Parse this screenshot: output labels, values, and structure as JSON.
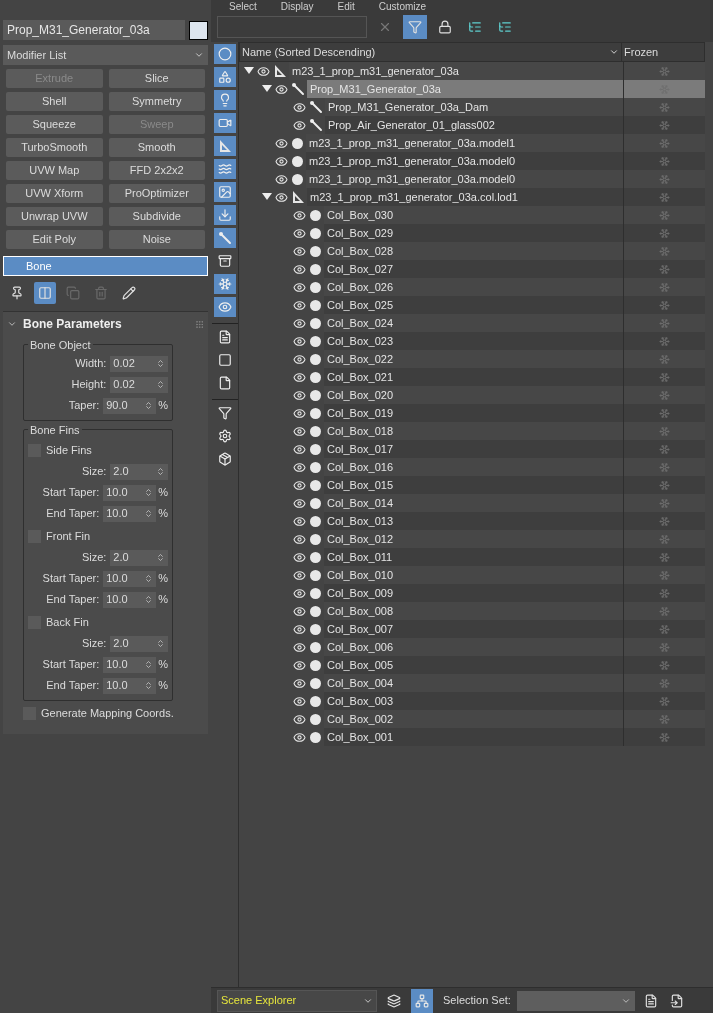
{
  "menu": [
    {
      "label": "Select"
    },
    {
      "label": "Display"
    },
    {
      "label": "Edit"
    },
    {
      "label": "Customize"
    }
  ],
  "object_name": "Prop_M31_Generator_03a",
  "modifier_list": "Modifier List",
  "modifier_buttons": [
    {
      "label": "Extrude",
      "disabled": true
    },
    {
      "label": "Slice",
      "disabled": false
    },
    {
      "label": "Shell",
      "disabled": false
    },
    {
      "label": "Symmetry",
      "disabled": false
    },
    {
      "label": "Squeeze",
      "disabled": false
    },
    {
      "label": "Sweep",
      "disabled": true
    },
    {
      "label": "TurboSmooth",
      "disabled": false
    },
    {
      "label": "Smooth",
      "disabled": false
    },
    {
      "label": "UVW Map",
      "disabled": false
    },
    {
      "label": "FFD 2x2x2",
      "disabled": false
    },
    {
      "label": "UVW Xform",
      "disabled": false
    },
    {
      "label": "ProOptimizer",
      "disabled": false
    },
    {
      "label": "Unwrap UVW",
      "disabled": false
    },
    {
      "label": "Subdivide",
      "disabled": false
    },
    {
      "label": "Edit Poly",
      "disabled": false
    },
    {
      "label": "Noise",
      "disabled": false
    }
  ],
  "stack": [
    {
      "label": "Bone",
      "selected": true
    }
  ],
  "stack_tools": [
    {
      "kind": "pin",
      "on": false,
      "disabled": false
    },
    {
      "kind": "show-end",
      "on": true,
      "disabled": false
    },
    {
      "kind": "make-unique",
      "on": false,
      "disabled": true
    },
    {
      "kind": "remove",
      "on": false,
      "disabled": true
    },
    {
      "kind": "configure",
      "on": false,
      "disabled": false
    }
  ],
  "rollout": {
    "title": "Bone Parameters",
    "expanded": true,
    "groups": [
      {
        "title": "Bone Object",
        "items": [
          {
            "kind": "spinner",
            "label": "Width:",
            "value": "0.02"
          },
          {
            "kind": "spinner",
            "label": "Height:",
            "value": "0.02"
          },
          {
            "kind": "spinner",
            "label": "Taper:",
            "value": "90.0",
            "unit": "%"
          }
        ]
      },
      {
        "title": "Bone Fins",
        "items": [
          {
            "kind": "checkbox",
            "label": "Side Fins",
            "checked": false
          },
          {
            "kind": "spinner",
            "label": "Size:",
            "value": "2.0"
          },
          {
            "kind": "spinner",
            "label": "Start Taper:",
            "value": "10.0",
            "unit": "%"
          },
          {
            "kind": "spinner",
            "label": "End Taper:",
            "value": "10.0",
            "unit": "%"
          },
          {
            "kind": "checkbox",
            "label": "Front Fin",
            "checked": false
          },
          {
            "kind": "spinner",
            "label": "Size:",
            "value": "2.0"
          },
          {
            "kind": "spinner",
            "label": "Start Taper:",
            "value": "10.0",
            "unit": "%"
          },
          {
            "kind": "spinner",
            "label": "End Taper:",
            "value": "10.0",
            "unit": "%"
          },
          {
            "kind": "checkbox",
            "label": "Back Fin",
            "checked": false
          },
          {
            "kind": "spinner",
            "label": "Size:",
            "value": "2.0"
          },
          {
            "kind": "spinner",
            "label": "Start Taper:",
            "value": "10.0",
            "unit": "%"
          },
          {
            "kind": "spinner",
            "label": "End Taper:",
            "value": "10.0",
            "unit": "%"
          }
        ]
      }
    ],
    "options": [
      {
        "kind": "checkbox",
        "label": "Generate Mapping Coords.",
        "checked": false
      }
    ]
  },
  "explorer_tools": [
    {
      "kind": "clear",
      "on": false
    },
    {
      "kind": "filter",
      "on": true
    },
    {
      "kind": "lock",
      "on": false
    },
    {
      "kind": "expand",
      "on": false
    },
    {
      "kind": "collapse",
      "on": false
    }
  ],
  "side_toolbar": [
    {
      "kind": "geometry",
      "on": true
    },
    {
      "kind": "shapes",
      "on": true
    },
    {
      "kind": "lights",
      "on": true
    },
    {
      "kind": "cameras",
      "on": true
    },
    {
      "kind": "helpers",
      "on": true
    },
    {
      "kind": "spacewarps",
      "on": true
    },
    {
      "kind": "groups",
      "on": true
    },
    {
      "kind": "xrefs",
      "on": true
    },
    {
      "kind": "bones",
      "on": true
    },
    {
      "kind": "containers",
      "on": false
    },
    {
      "kind": "frozen",
      "on": true
    },
    {
      "kind": "hidden",
      "on": true
    },
    {
      "kind": "separator"
    },
    {
      "kind": "display-all",
      "on": false
    },
    {
      "kind": "display-none",
      "on": false
    },
    {
      "kind": "invert",
      "on": false
    },
    {
      "kind": "separator"
    },
    {
      "kind": "filter",
      "on": false
    },
    {
      "kind": "filter-settings",
      "on": false
    },
    {
      "kind": "container-open",
      "on": false
    }
  ],
  "columns": [
    "Name (Sorted Descending)",
    "Frozen"
  ],
  "tree": [
    {
      "name": "m23_1_prop_m31_generator_03a",
      "kind": "helper",
      "selected": false,
      "expanded": true,
      "children": [
        {
          "name": "Prop_M31_Generator_03a",
          "kind": "bone",
          "selected": true,
          "expanded": true,
          "children": [
            {
              "name": "Prop_M31_Generator_03a_Dam",
              "kind": "bone",
              "selected": false
            },
            {
              "name": "Prop_Air_Generator_01_glass002",
              "kind": "bone",
              "selected": false
            }
          ]
        },
        {
          "name": "m23_1_prop_m31_generator_03a.model1",
          "kind": "mesh",
          "selected": false
        },
        {
          "name": "m23_1_prop_m31_generator_03a.model0",
          "kind": "mesh",
          "selected": false
        },
        {
          "name": "m23_1_prop_m31_generator_03a.model0",
          "kind": "mesh",
          "selected": false
        },
        {
          "name": "m23_1_prop_m31_generator_03a.col.lod1",
          "kind": "helper",
          "selected": false,
          "expanded": true,
          "children": [
            {
              "name": "Col_Box_030",
              "kind": "mesh",
              "selected": false
            },
            {
              "name": "Col_Box_029",
              "kind": "mesh",
              "selected": false
            },
            {
              "name": "Col_Box_028",
              "kind": "mesh",
              "selected": false
            },
            {
              "name": "Col_Box_027",
              "kind": "mesh",
              "selected": false
            },
            {
              "name": "Col_Box_026",
              "kind": "mesh",
              "selected": false
            },
            {
              "name": "Col_Box_025",
              "kind": "mesh",
              "selected": false
            },
            {
              "name": "Col_Box_024",
              "kind": "mesh",
              "selected": false
            },
            {
              "name": "Col_Box_023",
              "kind": "mesh",
              "selected": false
            },
            {
              "name": "Col_Box_022",
              "kind": "mesh",
              "selected": false
            },
            {
              "name": "Col_Box_021",
              "kind": "mesh",
              "selected": false
            },
            {
              "name": "Col_Box_020",
              "kind": "mesh",
              "selected": false
            },
            {
              "name": "Col_Box_019",
              "kind": "mesh",
              "selected": false
            },
            {
              "name": "Col_Box_018",
              "kind": "mesh",
              "selected": false
            },
            {
              "name": "Col_Box_017",
              "kind": "mesh",
              "selected": false
            },
            {
              "name": "Col_Box_016",
              "kind": "mesh",
              "selected": false
            },
            {
              "name": "Col_Box_015",
              "kind": "mesh",
              "selected": false
            },
            {
              "name": "Col_Box_014",
              "kind": "mesh",
              "selected": false
            },
            {
              "name": "Col_Box_013",
              "kind": "mesh",
              "selected": false
            },
            {
              "name": "Col_Box_012",
              "kind": "mesh",
              "selected": false
            },
            {
              "name": "Col_Box_011",
              "kind": "mesh",
              "selected": false
            },
            {
              "name": "Col_Box_010",
              "kind": "mesh",
              "selected": false
            },
            {
              "name": "Col_Box_009",
              "kind": "mesh",
              "selected": false
            },
            {
              "name": "Col_Box_008",
              "kind": "mesh",
              "selected": false
            },
            {
              "name": "Col_Box_007",
              "kind": "mesh",
              "selected": false
            },
            {
              "name": "Col_Box_006",
              "kind": "mesh",
              "selected": false
            },
            {
              "name": "Col_Box_005",
              "kind": "mesh",
              "selected": false
            },
            {
              "name": "Col_Box_004",
              "kind": "mesh",
              "selected": false
            },
            {
              "name": "Col_Box_003",
              "kind": "mesh",
              "selected": false
            },
            {
              "name": "Col_Box_002",
              "kind": "mesh",
              "selected": false
            },
            {
              "name": "Col_Box_001",
              "kind": "mesh",
              "selected": false
            }
          ]
        }
      ]
    }
  ],
  "bottom": {
    "explorer_name": "Scene Explorer",
    "views": [
      {
        "kind": "layers",
        "selected": false
      },
      {
        "kind": "hierarchy",
        "selected": true
      }
    ],
    "selection_set_label": "Selection Set:",
    "tools": [
      {
        "kind": "select-list"
      },
      {
        "kind": "select-page"
      }
    ]
  }
}
